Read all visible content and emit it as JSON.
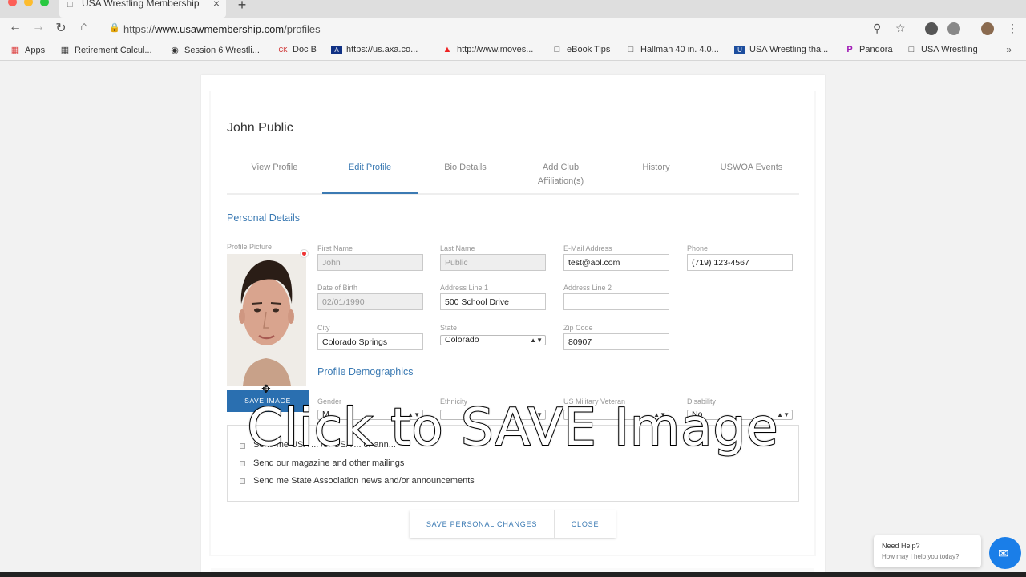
{
  "browser": {
    "tab_title": "USA Wrestling Membership",
    "url_prefix": "https://",
    "url_host": "www.usawmembership.com",
    "url_path": "/profiles",
    "bookmarks": [
      {
        "icon": "apps-grid-icon",
        "label": "Apps"
      },
      {
        "icon": "calculator-icon",
        "label": "Retirement Calcul..."
      },
      {
        "icon": "wrestling-icon",
        "label": "Session 6 Wrestli..."
      },
      {
        "icon": "cbk-icon",
        "label": "Doc B"
      },
      {
        "icon": "axa-icon",
        "label": "https://us.axa.co..."
      },
      {
        "icon": "moves-icon",
        "label": "http://www.moves..."
      },
      {
        "icon": "document-icon",
        "label": "eBook Tips"
      },
      {
        "icon": "document-icon",
        "label": "Hallman 40 in. 4.0..."
      },
      {
        "icon": "usaw-icon",
        "label": "USA Wrestling tha..."
      },
      {
        "icon": "pandora-icon",
        "label": "Pandora"
      },
      {
        "icon": "document-icon",
        "label": "USA Wrestling"
      }
    ],
    "bookmarks_more": "»"
  },
  "profile": {
    "name": "John Public",
    "tabs": [
      "View Profile",
      "Edit Profile",
      "Bio Details",
      "Add Club Affiliation(s)",
      "History",
      "USWOA Events"
    ],
    "active_tab": "Edit Profile"
  },
  "personal": {
    "section_title": "Personal Details",
    "picture_label": "Profile Picture",
    "first_name_label": "First Name",
    "first_name": "John",
    "last_name_label": "Last Name",
    "last_name": "Public",
    "email_label": "E-Mail Address",
    "email": "test@aol.com",
    "phone_label": "Phone",
    "phone": "(719) 123-4567",
    "dob_label": "Date of Birth",
    "dob": "02/01/1990",
    "address1_label": "Address Line 1",
    "address1": "500 School Drive",
    "address2_label": "Address Line 2",
    "address2": "",
    "city_label": "City",
    "city": "Colorado Springs",
    "state_label": "State",
    "state": "Colorado",
    "zip_label": "Zip Code",
    "zip": "80907",
    "save_image": "SAVE IMAGE"
  },
  "demographics": {
    "section_title": "Profile Demographics",
    "gender_label": "Gender",
    "gender": "M",
    "ethnicity_label": "Ethnicity",
    "ethnicity": "",
    "veteran_label": "US Military Veteran",
    "veteran": "",
    "disability_label": "Disability",
    "disability": "No"
  },
  "preferences": [
    "Send me USA ... /or USA ... or ann...",
    "Send our magazine and other mailings",
    "Send me State Association news and/or announcements"
  ],
  "actions": {
    "save_changes": "SAVE PERSONAL CHANGES",
    "close": "CLOSE"
  },
  "overlay": "Click to SAVE Image",
  "help": {
    "title": "Need Help?",
    "subtitle": "How may I help you today?"
  },
  "colors": {
    "accent": "#3b7ab3",
    "save_button": "#2a6fb0",
    "chat": "#1a7ee8"
  }
}
